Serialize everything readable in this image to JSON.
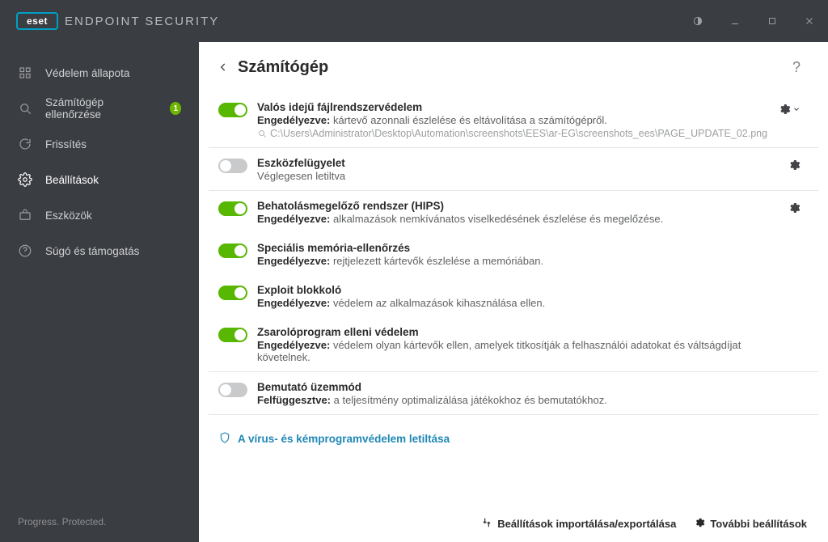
{
  "product": {
    "logo_text": "eset",
    "name": "ENDPOINT SECURITY"
  },
  "sidebar": {
    "items": [
      {
        "label": "Védelem állapota"
      },
      {
        "label": "Számítógép ellenőrzése",
        "badge": "1"
      },
      {
        "label": "Frissítés"
      },
      {
        "label": "Beállítások"
      },
      {
        "label": "Eszközök"
      },
      {
        "label": "Súgó és támogatás"
      }
    ],
    "tagline": "Progress. Protected."
  },
  "page": {
    "title": "Számítógép",
    "help": "?"
  },
  "rows": {
    "realtime": {
      "title": "Valós idejű fájlrendszervédelem",
      "state": "Engedélyezve:",
      "desc": "kártevő azonnali észlelése és eltávolítása a számítógépről.",
      "path": "C:\\Users\\Administrator\\Desktop\\Automation\\screenshots\\EES\\ar-EG\\screenshots_ees\\PAGE_UPDATE_02.png"
    },
    "device": {
      "title": "Eszközfelügyelet",
      "state": "",
      "desc": "Véglegesen letiltva"
    },
    "hips": {
      "title": "Behatolásmegelőző rendszer (HIPS)",
      "state": "Engedélyezve:",
      "desc": "alkalmazások nemkívánatos viselkedésének észlelése és megelőzése."
    },
    "memory": {
      "title": "Speciális memória-ellenőrzés",
      "state": "Engedélyezve:",
      "desc": "rejtjelezett kártevők észlelése a memóriában."
    },
    "exploit": {
      "title": "Exploit blokkoló",
      "state": "Engedélyezve:",
      "desc": "védelem az alkalmazások kihasználása ellen."
    },
    "ransom": {
      "title": "Zsarolóprogram elleni védelem",
      "state": "Engedélyezve:",
      "desc": "védelem olyan kártevők ellen, amelyek titkosítják a felhasználói adatokat és váltságdíjat követelnek."
    },
    "demo": {
      "title": "Bemutató üzemmód",
      "state": "Felfüggesztve:",
      "desc": "a teljesítmény optimalizálása játékokhoz és bemutatókhoz."
    }
  },
  "link": {
    "label": "A vírus- és kémprogramvédelem letiltása"
  },
  "footer": {
    "import_export": "Beállítások importálása/exportálása",
    "more": "További beállítások"
  }
}
